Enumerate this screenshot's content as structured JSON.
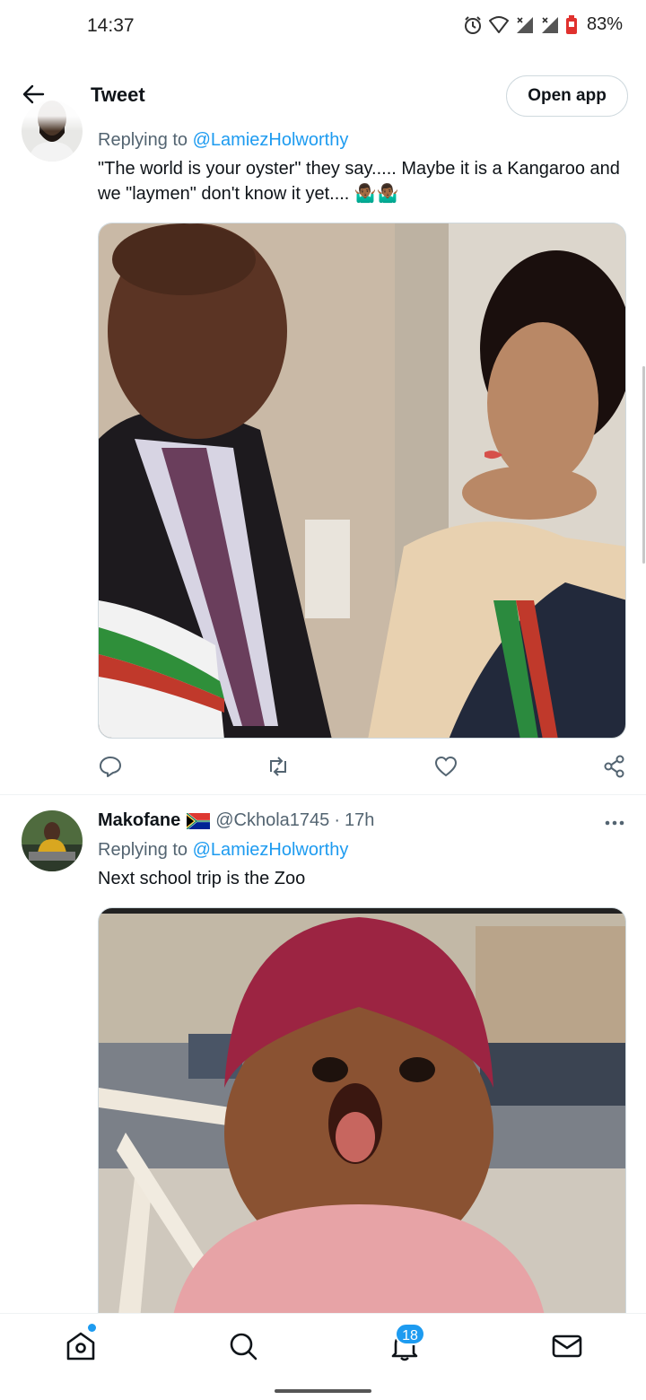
{
  "status_bar": {
    "time": "14:37",
    "battery_percent": "83%",
    "icons": [
      "alarm-icon",
      "wifi-icon",
      "signal-icon",
      "signal-icon",
      "battery-icon"
    ]
  },
  "header": {
    "title": "Tweet",
    "open_app_label": "Open app"
  },
  "tweets": [
    {
      "reply_prefix": "Replying to",
      "reply_handle": "@LamiezHolworthy",
      "text": "\"The world is your oyster\" they say..... Maybe it is a Kangaroo and we \"laymen\" don't know it yet.... 🤷🏾‍♂️🤷🏾‍♂️",
      "actions": [
        "reply-icon",
        "retweet-icon",
        "like-icon",
        "share-icon"
      ]
    },
    {
      "display_name": "Makofane",
      "flag": "South Africa flag",
      "handle": "@Ckhola1745",
      "separator": "·",
      "time_ago": "17h",
      "reply_prefix": "Replying to",
      "reply_handle": "@LamiezHolworthy",
      "text": "Next school trip is the Zoo"
    }
  ],
  "bottom_nav": {
    "items": [
      "home-icon",
      "search-icon",
      "notifications-icon",
      "messages-icon"
    ],
    "notification_count": "18"
  },
  "colors": {
    "accent": "#1d9bf0",
    "text_primary": "#0f1419",
    "text_secondary": "#536471",
    "border": "#cfd9de"
  }
}
